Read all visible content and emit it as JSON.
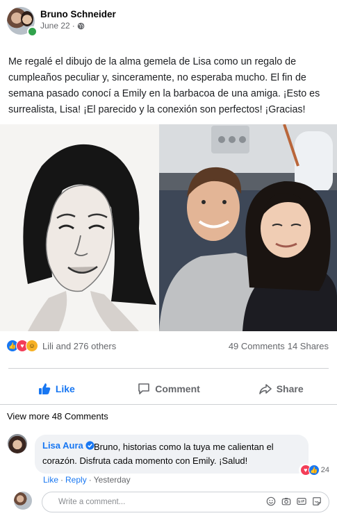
{
  "post": {
    "author": "Bruno Schneider",
    "date": "June 22",
    "separator": "·",
    "text": "Me regalé el dibujo de la alma gemela de Lisa como un regalo de cumpleaños peculiar y, sinceramente, no esperaba mucho. El fin de semana pasado conocí a Emily en la barbacoa de una amiga. ¡Esto es surrealista, Lisa! ¡El parecido y la conexión son perfectos! ¡Gracias!"
  },
  "reactions": {
    "summary": "Lili and 276 others",
    "comments": "49 Comments",
    "shares": "14 Shares"
  },
  "actions": {
    "like": "Like",
    "comment": "Comment",
    "share": "Share"
  },
  "comments": {
    "view_more": "View more 48 Comments",
    "items": [
      {
        "name": "Lisa Aura",
        "text": "Bruno, historias como la tuya me calientan el corazón. Disfruta cada momento con Emily. ¡Salud!",
        "reaction_count": "24",
        "like": "Like",
        "reply": "Reply",
        "time": "Yesterday",
        "dot": "·"
      }
    ]
  },
  "composer": {
    "placeholder": "Write a comment..."
  },
  "colors": {
    "accent": "#1877f2",
    "online": "#31a24c",
    "love": "#f33e58"
  }
}
